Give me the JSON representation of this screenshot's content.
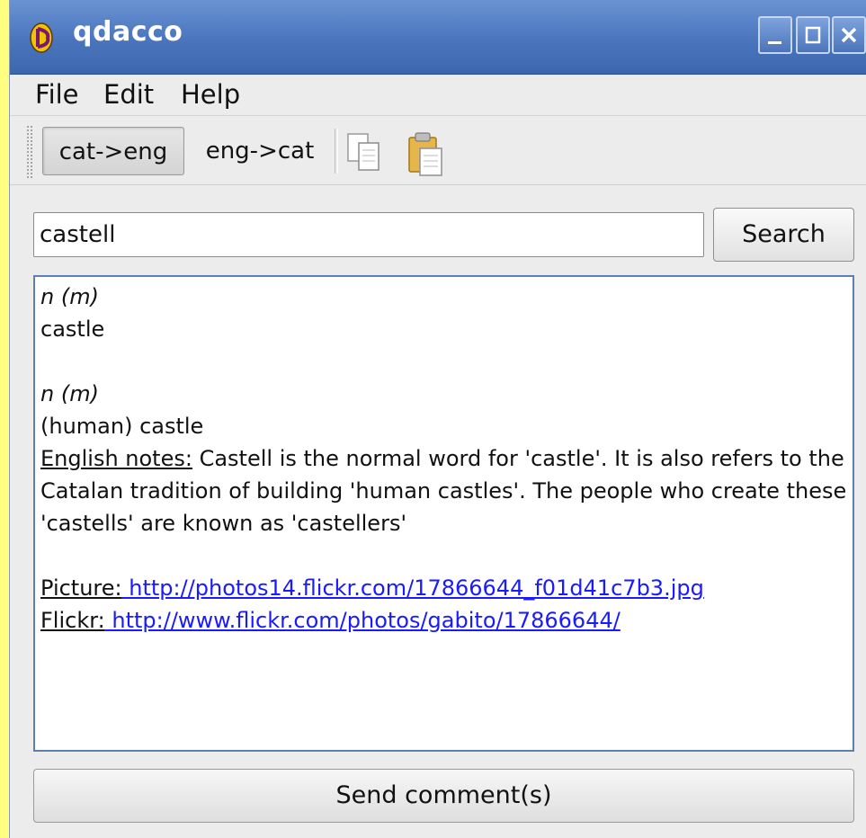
{
  "window": {
    "title": "qdacco",
    "controls": [
      "minimize-icon",
      "maximize-icon",
      "close-icon"
    ]
  },
  "menu": {
    "file": "File",
    "edit": "Edit",
    "help": "Help"
  },
  "toolbar": {
    "cat_eng": "cat->eng",
    "eng_cat": "eng->cat",
    "active": "cat->eng",
    "icons": [
      "copy-icon",
      "paste-icon"
    ]
  },
  "search": {
    "value": "castell",
    "button": "Search"
  },
  "results": {
    "entry1_pos": "n (m)",
    "entry1_translation": "castle",
    "entry2_pos": "n (m)",
    "entry2_translation": "(human) castle",
    "notes_label": "English notes:",
    "notes_text": " Castell is the normal word for 'castle'. It is also refers to the Catalan tradition of building 'human castles'. The people who create these 'castells' are known as 'castellers'",
    "picture_label": "Picture:",
    "picture_url": " http://photos14.flickr.com/17866644_f01d41c7b3.jpg",
    "flickr_label": "Flickr:",
    "flickr_url": " http://www.flickr.com/photos/gabito/17866644/"
  },
  "footer": {
    "send_comments": "Send comment(s)"
  },
  "colors": {
    "titlebar": "#4a75bd",
    "link": "#1a1aff",
    "desktop": "#ffff80"
  }
}
